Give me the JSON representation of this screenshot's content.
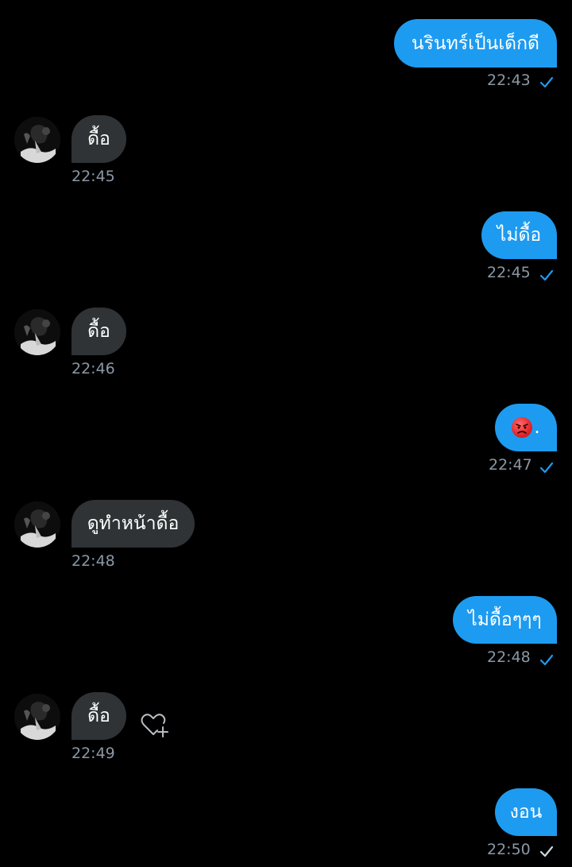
{
  "colors": {
    "background": "#000000",
    "outgoing_bubble": "#1d9bf0",
    "incoming_bubble": "#2f3336",
    "timestamp": "#8b98a5",
    "read_check": "#1d9bf0",
    "sent_check": "#cfd9de"
  },
  "messages": [
    {
      "direction": "out",
      "text": "นรินทร์เป็นเด็กดี",
      "time": "22:43",
      "status": "read"
    },
    {
      "direction": "in",
      "text": "ดื้อ",
      "time": "22:45"
    },
    {
      "direction": "out",
      "text": "ไม่ดื้อ",
      "time": "22:45",
      "status": "read"
    },
    {
      "direction": "in",
      "text": "ดื้อ",
      "time": "22:46"
    },
    {
      "direction": "out",
      "text": ".",
      "emoji": "angry-face",
      "time": "22:47",
      "status": "read"
    },
    {
      "direction": "in",
      "text": "ดูทำหน้าดื้อ",
      "time": "22:48"
    },
    {
      "direction": "out",
      "text": "ไม่ดื้อๆๆๆ",
      "time": "22:48",
      "status": "read"
    },
    {
      "direction": "in",
      "text": "ดื้อ",
      "time": "22:49",
      "reaction_button": "add-reaction-heart-icon"
    },
    {
      "direction": "out",
      "text": "งอน",
      "time": "22:50",
      "status": "sent"
    }
  ]
}
